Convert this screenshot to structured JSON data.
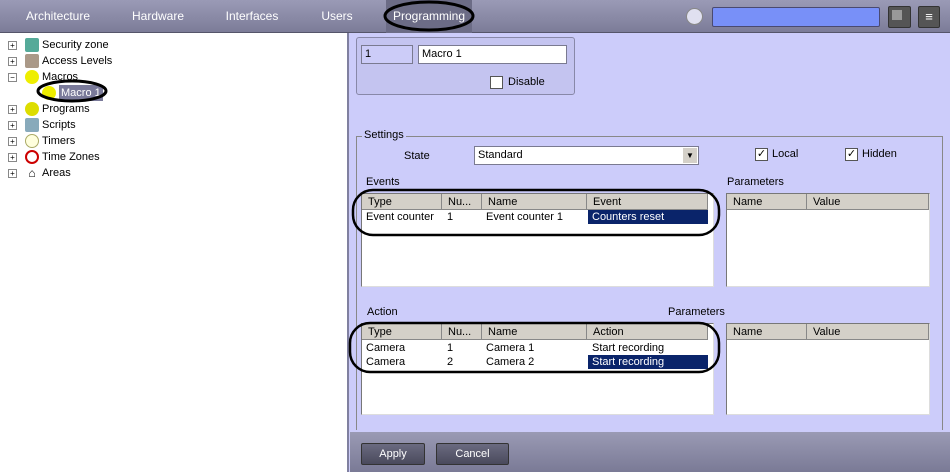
{
  "top_tabs": [
    "Architecture",
    "Hardware",
    "Interfaces",
    "Users",
    "Programming"
  ],
  "search": {
    "value": ""
  },
  "tree": [
    {
      "label": "Security zone",
      "icon": "security-zone-icon"
    },
    {
      "label": "Access Levels",
      "icon": "access-levels-icon"
    },
    {
      "label": "Macros",
      "icon": "macros-icon"
    },
    {
      "label": "Macro 1",
      "icon": "macro-icon"
    },
    {
      "label": "Programs",
      "icon": "programs-icon"
    },
    {
      "label": "Scripts",
      "icon": "scripts-icon"
    },
    {
      "label": "Timers",
      "icon": "timers-icon"
    },
    {
      "label": "Time Zones",
      "icon": "time-zones-icon"
    },
    {
      "label": "Areas",
      "icon": "areas-icon"
    }
  ],
  "object": {
    "id": "1",
    "name": "Macro 1",
    "disable_label": "Disable"
  },
  "settings": {
    "title": "Settings",
    "state_label": "State",
    "state_value": "Standard",
    "local_label": "Local",
    "hidden_label": "Hidden",
    "events_label": "Events",
    "parameters_label": "Parameters",
    "action_label": "Action",
    "action_parameters_label": "Parameters"
  },
  "events": {
    "columns": [
      "Type",
      "Nu...",
      "Name",
      "Event"
    ],
    "rows": [
      [
        "Event counter",
        "1",
        "Event counter 1",
        "Counters reset"
      ]
    ]
  },
  "event_params": {
    "columns": [
      "Name",
      "Value"
    ]
  },
  "actions": {
    "columns": [
      "Type",
      "Nu...",
      "Name",
      "Action"
    ],
    "rows": [
      [
        "Camera",
        "1",
        "Camera 1",
        "Start recording"
      ],
      [
        "Camera",
        "2",
        "Camera 2",
        "Start recording"
      ]
    ]
  },
  "action_params": {
    "columns": [
      "Name",
      "Value"
    ]
  },
  "buttons": {
    "apply": "Apply",
    "cancel": "Cancel"
  }
}
